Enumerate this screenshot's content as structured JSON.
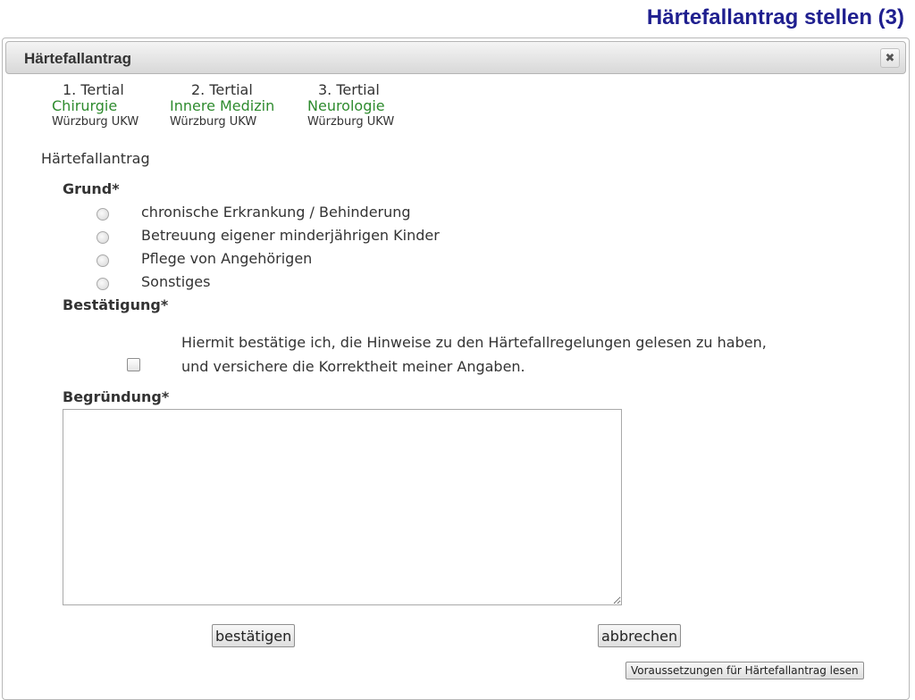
{
  "slide_title": "Härtefallantrag stellen (3)",
  "dialog": {
    "title": "Härtefallantrag",
    "close_symbol": "✖"
  },
  "tertials": [
    {
      "number": "1. Tertial",
      "subject": "Chirurgie",
      "location": "Würzburg UKW"
    },
    {
      "number": "2. Tertial",
      "subject": "Innere Medizin",
      "location": "Würzburg UKW"
    },
    {
      "number": "3. Tertial",
      "subject": "Neurologie",
      "location": "Würzburg UKW"
    }
  ],
  "form": {
    "section_heading": "Härtefallantrag",
    "grund_label": "Grund*",
    "grund_options": [
      "chronische Erkrankung / Behinderung",
      "Betreuung eigener minderjährigen Kinder",
      "Pflege von Angehörigen",
      "Sonstiges"
    ],
    "bestaetigung_label": "Bestätigung*",
    "bestaetigung_text": "Hiermit bestätige ich, die Hinweise zu den Härtefallregelungen gelesen zu haben, und versichere die Korrektheit meiner Angaben.",
    "begruendung_label": "Begründung*",
    "begruendung_value": ""
  },
  "buttons": {
    "confirm": "bestätigen",
    "cancel": "abbrechen",
    "requirements": "Voraussetzungen für Härtefallantrag lesen"
  },
  "icons": {
    "close": "close-icon"
  }
}
